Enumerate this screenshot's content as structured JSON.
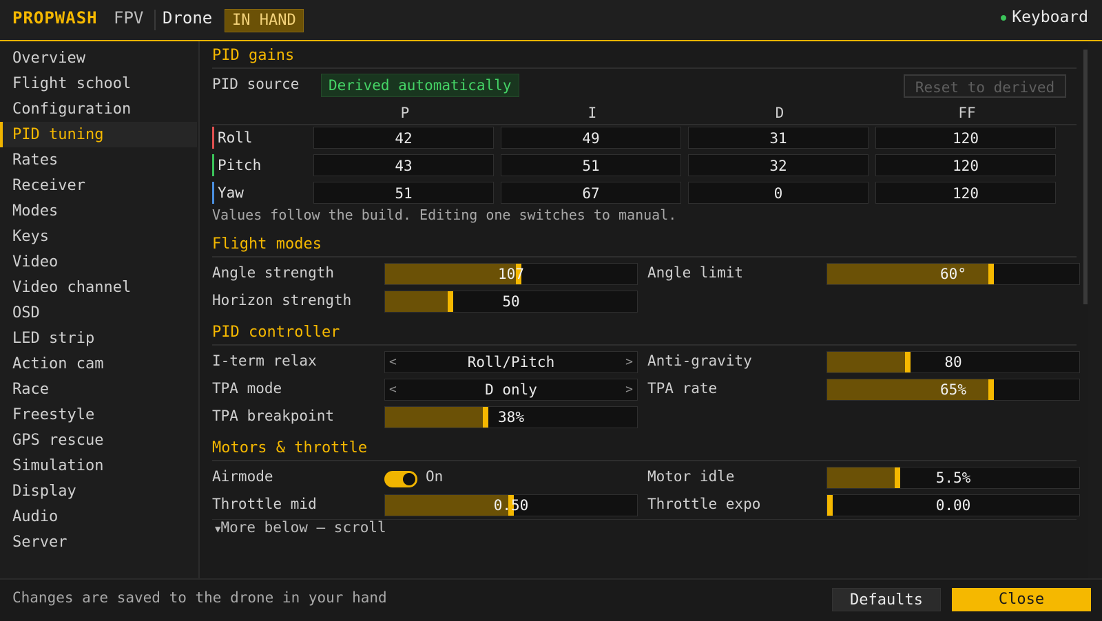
{
  "header": {
    "brand": "PROPWASH",
    "brand_suffix": "FPV",
    "context": "Drone",
    "badge": "IN HAND",
    "input_mode": "Keyboard"
  },
  "sidebar": {
    "items": [
      {
        "label": "Overview",
        "active": false
      },
      {
        "label": "Flight school",
        "active": false
      },
      {
        "label": "Configuration",
        "active": false
      },
      {
        "label": "PID tuning",
        "active": true
      },
      {
        "label": "Rates",
        "active": false
      },
      {
        "label": "Receiver",
        "active": false
      },
      {
        "label": "Modes",
        "active": false
      },
      {
        "label": "Keys",
        "active": false
      },
      {
        "label": "Video",
        "active": false
      },
      {
        "label": "Video channel",
        "active": false
      },
      {
        "label": "OSD",
        "active": false
      },
      {
        "label": "LED strip",
        "active": false
      },
      {
        "label": "Action cam",
        "active": false
      },
      {
        "label": "Race",
        "active": false
      },
      {
        "label": "Freestyle",
        "active": false
      },
      {
        "label": "GPS rescue",
        "active": false
      },
      {
        "label": "Simulation",
        "active": false
      },
      {
        "label": "Display",
        "active": false
      },
      {
        "label": "Audio",
        "active": false
      },
      {
        "label": "Server",
        "active": false
      }
    ]
  },
  "pid_gains": {
    "title": "PID gains",
    "source_label": "PID source",
    "source_value": "Derived automatically",
    "reset_label": "Reset to derived",
    "columns": [
      "P",
      "I",
      "D",
      "FF"
    ],
    "rows": [
      {
        "axis": "Roll",
        "color": "#e05050",
        "values": [
          "42",
          "49",
          "31",
          "120"
        ]
      },
      {
        "axis": "Pitch",
        "color": "#3bc45a",
        "values": [
          "43",
          "51",
          "32",
          "120"
        ]
      },
      {
        "axis": "Yaw",
        "color": "#4a8fe0",
        "values": [
          "51",
          "67",
          "0",
          "120"
        ]
      }
    ],
    "note": "Values follow the build. Editing one switches to manual."
  },
  "flight_modes": {
    "title": "Flight modes",
    "angle_strength": {
      "label": "Angle strength",
      "value": "107",
      "level": 0.53
    },
    "angle_limit": {
      "label": "Angle limit",
      "value": "60°",
      "level": 0.65
    },
    "horizon_strength": {
      "label": "Horizon strength",
      "value": "50",
      "level": 0.26
    }
  },
  "pid_controller": {
    "title": "PID controller",
    "iterm_relax": {
      "label": "I-term relax",
      "value": "Roll/Pitch"
    },
    "anti_gravity": {
      "label": "Anti-gravity",
      "value": "80",
      "level": 0.32
    },
    "tpa_mode": {
      "label": "TPA mode",
      "value": "D only"
    },
    "tpa_rate": {
      "label": "TPA rate",
      "value": "65%",
      "level": 0.65
    },
    "tpa_breakpoint": {
      "label": "TPA breakpoint",
      "value": "38%",
      "level": 0.4
    }
  },
  "motors": {
    "title": "Motors & throttle",
    "airmode": {
      "label": "Airmode",
      "value": "On"
    },
    "motor_idle": {
      "label": "Motor idle",
      "value": "5.5%",
      "level": 0.28
    },
    "throttle_mid": {
      "label": "Throttle mid",
      "value": "0.50",
      "level": 0.5
    },
    "throttle_expo": {
      "label": "Throttle expo",
      "value": "0.00",
      "level": 0.0
    }
  },
  "more_hint": "More below — scroll",
  "footer": {
    "status": "Changes are saved to the drone in your hand",
    "defaults_label": "Defaults",
    "close_label": "Close"
  },
  "colors": {
    "accent": "#f5b800",
    "fill": "#6b5106",
    "ok": "#45d466"
  }
}
